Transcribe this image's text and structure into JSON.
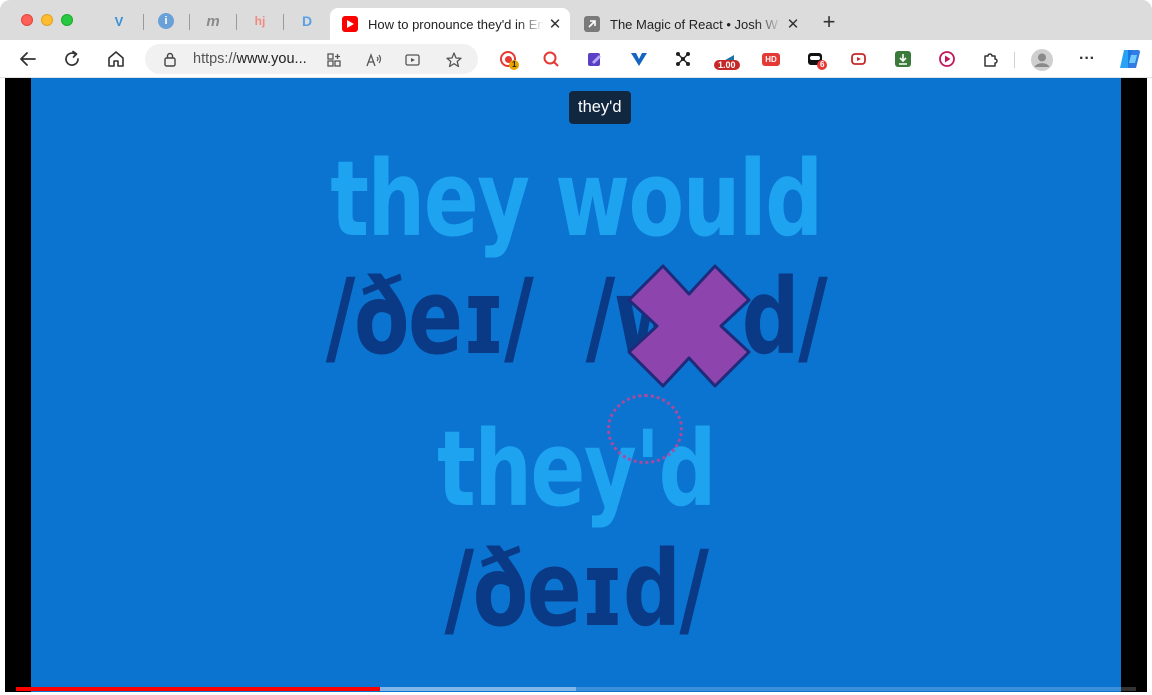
{
  "browser": {
    "pinned_tabs": [
      {
        "icon": "v-logo-icon",
        "glyph": "V",
        "color": "#3b8fd6"
      },
      {
        "icon": "info-icon",
        "glyph": "i",
        "color": "#6aa0d8"
      },
      {
        "icon": "m-logo-icon",
        "glyph": "m",
        "color": "#8a8a8a"
      },
      {
        "icon": "hj-logo-icon",
        "glyph": "hj",
        "color": "#f08a80"
      },
      {
        "icon": "d-logo-icon",
        "glyph": "D",
        "color": "#5aa0e6"
      }
    ],
    "tabs": [
      {
        "title": "How to pronounce they'd in English",
        "icon": "youtube-icon",
        "active": true,
        "color": "#ff0000"
      },
      {
        "title": "The Magic of React • Josh W Comeau",
        "icon": "arrow-icon",
        "active": false,
        "color": "#7a7a7a"
      }
    ],
    "new_tab_label": "+",
    "close_glyph": "✕",
    "address": {
      "protocol": "https://",
      "host": "www.you..."
    },
    "extensions": [
      {
        "icon": "record-ext-icon",
        "badge": "1",
        "badge_color": "#e6a300"
      },
      {
        "icon": "search-ext-icon",
        "badge": "",
        "badge_color": ""
      },
      {
        "icon": "note-ext-icon",
        "badge": "",
        "badge_color": ""
      },
      {
        "icon": "v-ext-icon",
        "badge": "",
        "badge_color": ""
      },
      {
        "icon": "graph-ext-icon",
        "badge": "",
        "badge_color": ""
      },
      {
        "icon": "speed-ext-icon",
        "badge": "1.00",
        "badge_color": "#c62828"
      },
      {
        "icon": "hd-ext-icon",
        "badge": "HD",
        "badge_color": "#e53935"
      },
      {
        "icon": "mask-ext-icon",
        "badge": "6",
        "badge_color": "#e53935"
      },
      {
        "icon": "video-ext-icon",
        "badge": "",
        "badge_color": ""
      },
      {
        "icon": "download-ext-icon",
        "badge": "",
        "badge_color": ""
      },
      {
        "icon": "play-ext-icon",
        "badge": "",
        "badge_color": ""
      },
      {
        "icon": "puzzle-icon",
        "badge": "",
        "badge_color": ""
      }
    ],
    "more_glyph": "···"
  },
  "video": {
    "caption": "they'd",
    "line1": "they would",
    "line2_left": "/ðeɪ/",
    "line2_right_start": "/w",
    "line2_right_end": "d/",
    "line3": "they'd",
    "line4": "/ðeɪd/",
    "progress_played": 0.325,
    "progress_buffered": 0.5,
    "colors": {
      "background": "#0b74d1",
      "word": "#1ea3f0",
      "ipa": "#0a3a86",
      "cross": "#8e44ad",
      "caption_bg": "#11263f"
    }
  }
}
